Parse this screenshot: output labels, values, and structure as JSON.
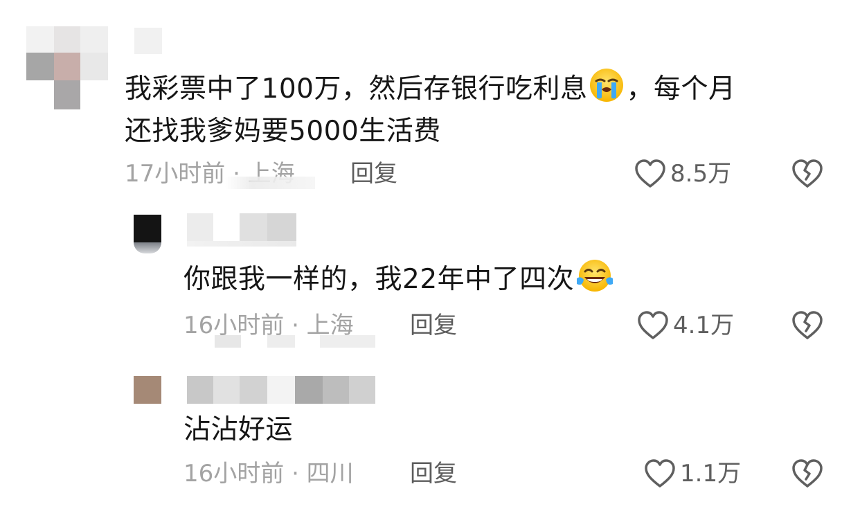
{
  "comments": [
    {
      "text_line1": "我彩票中了100万，然后存银行吃利息",
      "text_line1_end": "，每个月",
      "text_line2": "还找我爹妈要5000生活费",
      "time": "17小时前 · 上海",
      "reply_label": "回复",
      "likes": "8.5万",
      "emoji_icon": "loudly-crying-face-icon"
    },
    {
      "text": "你跟我一样的，我22年中了四次",
      "time": "16小时前 · 上海",
      "reply_label": "回复",
      "likes": "4.1万",
      "emoji_icon": "tears-of-joy-face-icon"
    },
    {
      "text": "沾沾好运",
      "time": "16小时前 · 四川",
      "reply_label": "回复",
      "likes": "1.1万"
    }
  ],
  "colors": {
    "text": "#161616",
    "meta": "#a3a3a3",
    "icon": "#5f5f5f"
  }
}
